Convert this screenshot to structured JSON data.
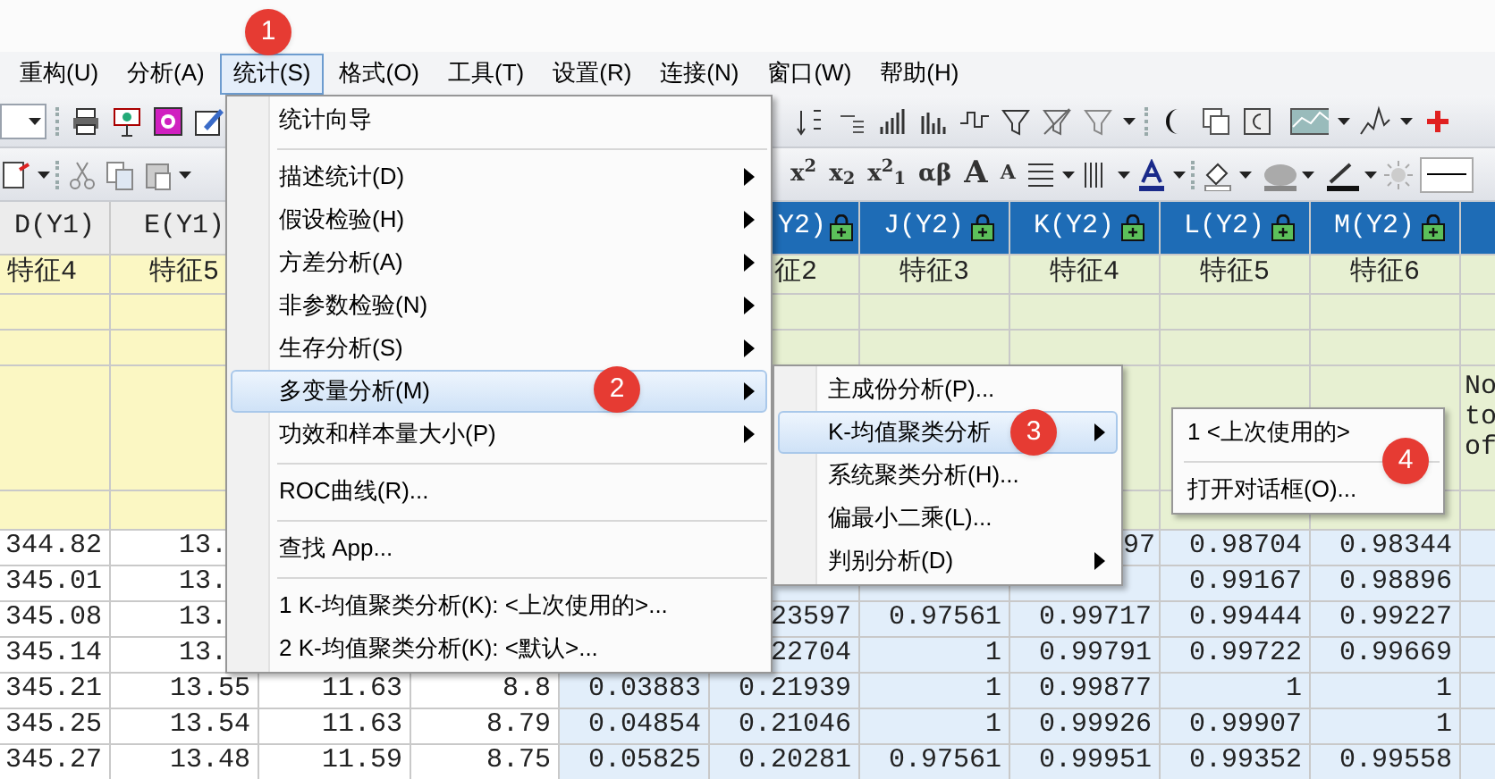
{
  "menu_bar": [
    {
      "label": "重构(U)",
      "selected": false
    },
    {
      "label": "分析(A)",
      "selected": false
    },
    {
      "label": "统计(S)",
      "selected": true
    },
    {
      "label": "格式(O)",
      "selected": false
    },
    {
      "label": "工具(T)",
      "selected": false
    },
    {
      "label": "设置(R)",
      "selected": false
    },
    {
      "label": "连接(N)",
      "selected": false
    },
    {
      "label": "窗口(W)",
      "selected": false
    },
    {
      "label": "帮助(H)",
      "selected": false
    }
  ],
  "format_toolbar": [
    "x$^{2}$",
    "x$_{2}$",
    "x$^{2}$$_{1}$",
    "αβ",
    "A",
    "A"
  ],
  "grid": {
    "columns": {
      "D": {
        "label": "D(Y1)",
        "kind": "plain"
      },
      "E": {
        "label": "E(Y1)",
        "kind": "plain"
      },
      "I": {
        "label": "Y2)",
        "kind": "locked"
      },
      "J": {
        "label": "J(Y2)",
        "kind": "locked"
      },
      "K": {
        "label": "K(Y2)",
        "kind": "locked"
      },
      "L": {
        "label": "L(Y2)",
        "kind": "locked"
      },
      "M": {
        "label": "M(Y2)",
        "kind": "locked"
      },
      "N": {
        "kind": "locked"
      }
    },
    "long_names": {
      "D": "特征4",
      "E": "特征5",
      "I": "征2",
      "J": "特征3",
      "K": "特征4",
      "L": "特征5",
      "M": "特征6"
    },
    "comments": {
      "N": "No\nto\nof"
    },
    "rows": [
      {
        "D": "344.82",
        "E": "13.",
        "K": "97",
        "L": "0.98704",
        "M": "0.98344"
      },
      {
        "D": "345.01",
        "E": "13.",
        "L": "0.99167",
        "M": "0.98896"
      },
      {
        "D": "345.08",
        "E": "13.",
        "I": "23597",
        "J": "0.97561",
        "K": "0.99717",
        "L": "0.99444",
        "M": "0.99227"
      },
      {
        "D": "345.14",
        "E": "13.",
        "I": "22704",
        "J": "1",
        "K": "0.99791",
        "L": "0.99722",
        "M": "0.99669"
      },
      {
        "D": "345.21",
        "E": "13.55",
        "F": "11.63",
        "G": "8.8",
        "H": "0.03883",
        "I": "0.21939",
        "J": "1",
        "K": "0.99877",
        "L": "1",
        "M": "1"
      },
      {
        "D": "345.25",
        "E": "13.54",
        "F": "11.63",
        "G": "8.79",
        "H": "0.04854",
        "I": "0.21046",
        "J": "1",
        "K": "0.99926",
        "L": "0.99907",
        "M": "1"
      },
      {
        "D": "345.27",
        "E": "13.48",
        "F": "11.59",
        "G": "8.75",
        "H": "0.05825",
        "I": "0.20281",
        "J": "0.97561",
        "K": "0.99951",
        "L": "0.99352",
        "M": "0.99558"
      }
    ]
  },
  "stats_menu": [
    {
      "kind": "item",
      "label": "统计向导",
      "submenu": false,
      "selected": false
    },
    {
      "kind": "separator"
    },
    {
      "kind": "item",
      "label": "描述统计(D)",
      "submenu": true,
      "selected": false
    },
    {
      "kind": "item",
      "label": "假设检验(H)",
      "submenu": true,
      "selected": false
    },
    {
      "kind": "item",
      "label": "方差分析(A)",
      "submenu": true,
      "selected": false
    },
    {
      "kind": "item",
      "label": "非参数检验(N)",
      "submenu": true,
      "selected": false
    },
    {
      "kind": "item",
      "label": "生存分析(S)",
      "submenu": true,
      "selected": false
    },
    {
      "kind": "item",
      "label": "多变量分析(M)",
      "submenu": true,
      "selected": true
    },
    {
      "kind": "item",
      "label": "功效和样本量大小(P)",
      "submenu": true,
      "selected": false
    },
    {
      "kind": "separator"
    },
    {
      "kind": "item",
      "label": "ROC曲线(R)...",
      "submenu": false,
      "selected": false
    },
    {
      "kind": "separator"
    },
    {
      "kind": "item",
      "label": "查找 App...",
      "submenu": false,
      "selected": false
    },
    {
      "kind": "separator"
    },
    {
      "kind": "item",
      "label": "1 K-均值聚类分析(K): <上次使用的>...",
      "submenu": false,
      "selected": false
    },
    {
      "kind": "item",
      "label": "2 K-均值聚类分析(K): <默认>...",
      "submenu": false,
      "selected": false
    }
  ],
  "multivariate_menu": [
    {
      "kind": "item",
      "label": "主成份分析(P)...",
      "submenu": false,
      "selected": false
    },
    {
      "kind": "item",
      "label": "K-均值聚类分析",
      "submenu": true,
      "selected": true
    },
    {
      "kind": "item",
      "label": "系统聚类分析(H)...",
      "submenu": false,
      "selected": false
    },
    {
      "kind": "item",
      "label": "偏最小二乘(L)...",
      "submenu": false,
      "selected": false
    },
    {
      "kind": "item",
      "label": "判别分析(D)",
      "submenu": true,
      "selected": false
    }
  ],
  "kmeans_menu": [
    {
      "kind": "item",
      "label": "1 <上次使用的>",
      "submenu": false,
      "selected": false
    },
    {
      "kind": "separator"
    },
    {
      "kind": "item",
      "label": "打开对话框(O)...",
      "submenu": false,
      "selected": false
    }
  ],
  "step_badges": [
    "1",
    "2",
    "3",
    "4"
  ]
}
